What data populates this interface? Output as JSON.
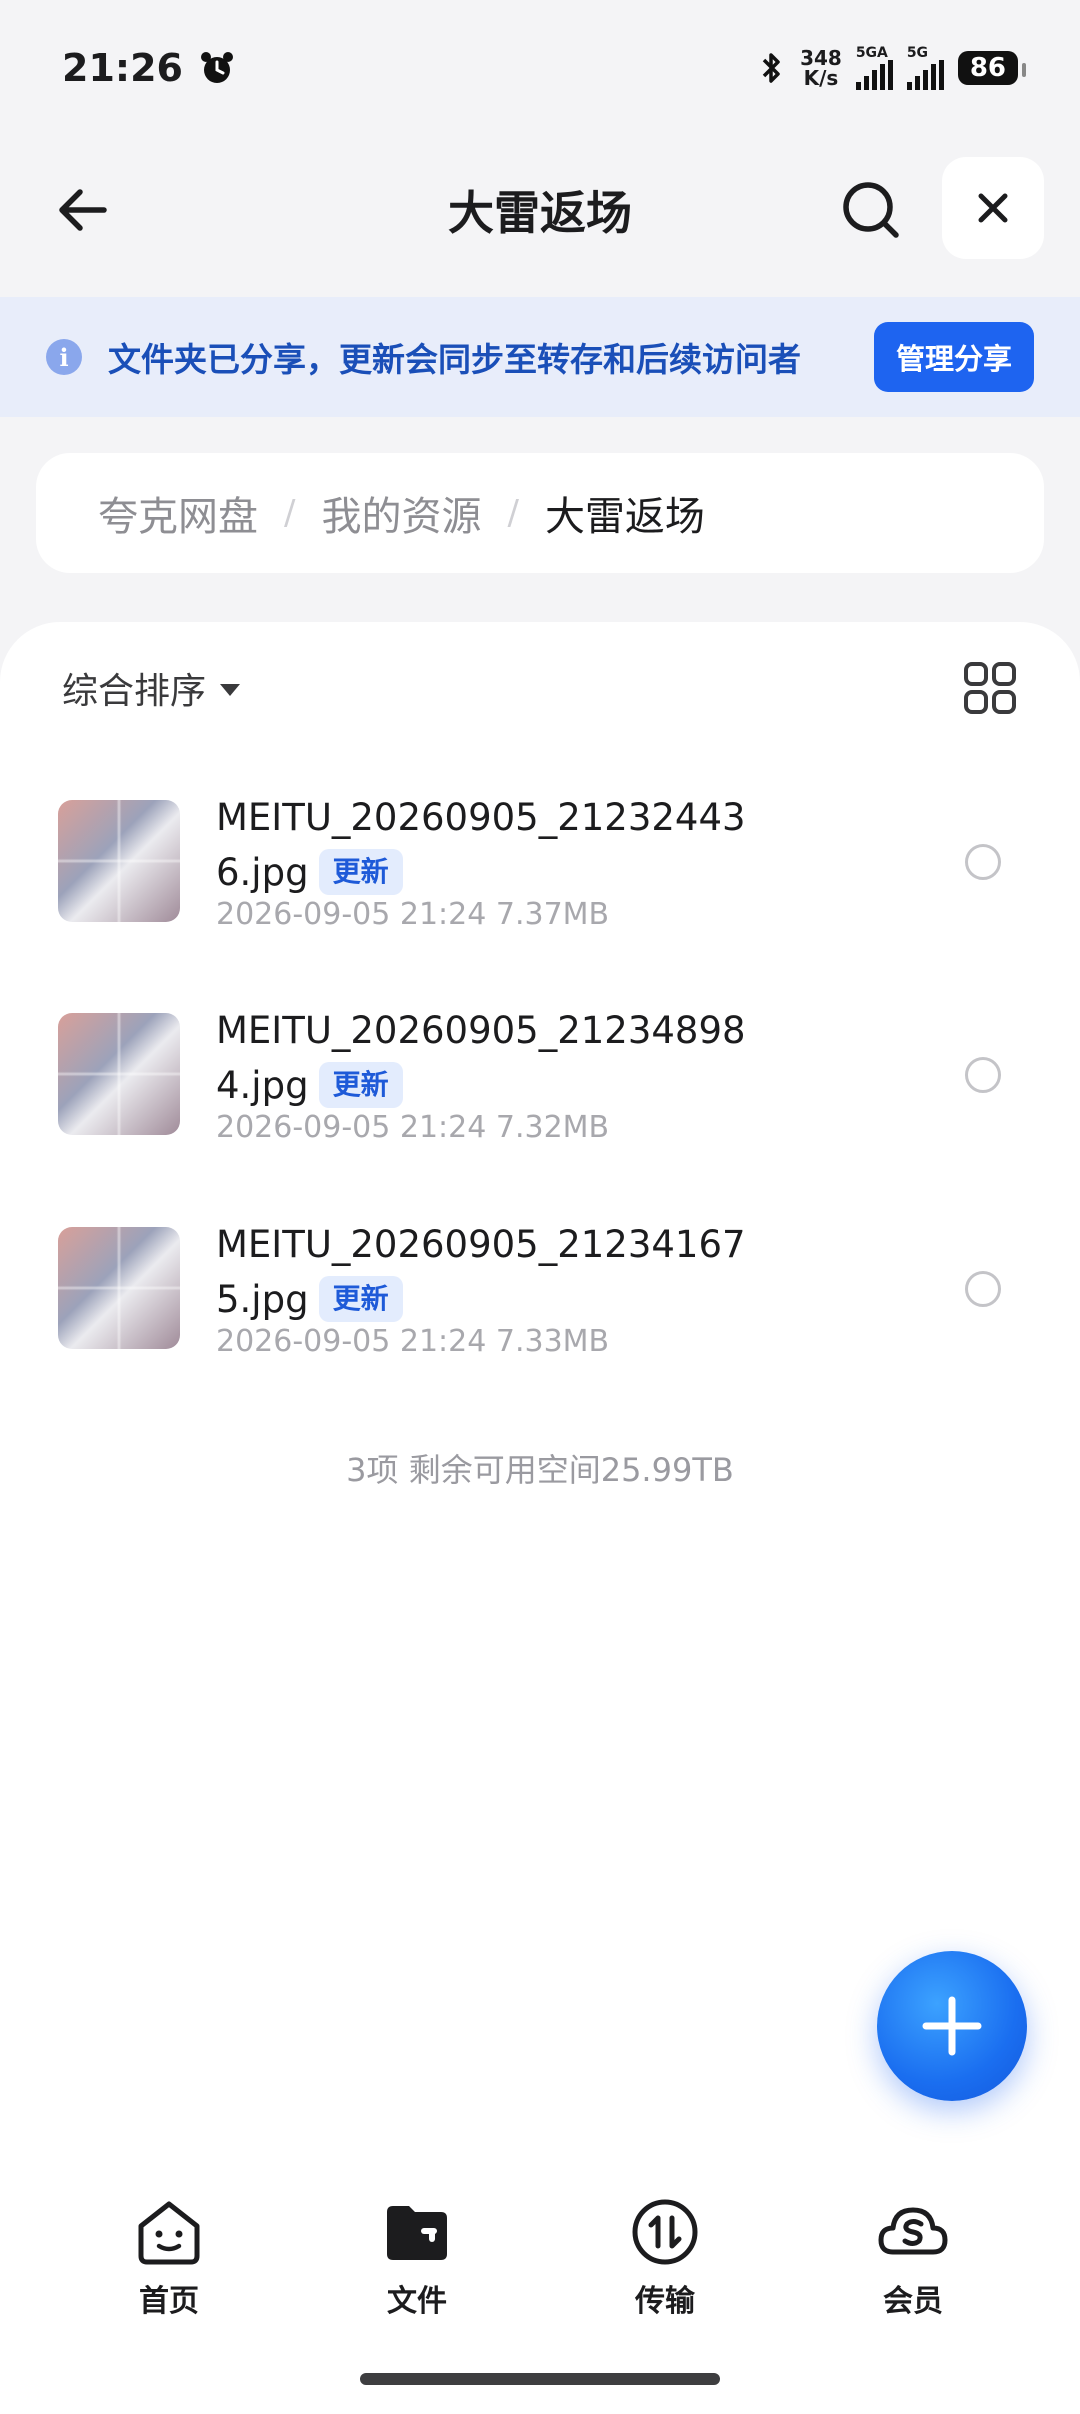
{
  "status_bar": {
    "time": "21:26",
    "speed_value": "348",
    "speed_unit": "K/s",
    "net1": "5GA",
    "net2": "5G",
    "battery": "86"
  },
  "nav": {
    "title": "大雷返场"
  },
  "share_banner": {
    "text": "文件夹已分享，更新会同步至转存和后续访问者",
    "button_label": "管理分享"
  },
  "breadcrumb": {
    "items": [
      "夸克网盘",
      "我的资源"
    ],
    "current": "大雷返场",
    "separator": "/"
  },
  "toolbar": {
    "sort_label": "综合排序"
  },
  "files": [
    {
      "name": "MEITU_20260905_212324436.jpg",
      "badge": "更新",
      "meta": "2026-09-05 21:24  7.37MB"
    },
    {
      "name": "MEITU_20260905_212348984.jpg",
      "badge": "更新",
      "meta": "2026-09-05 21:24  7.32MB"
    },
    {
      "name": "MEITU_20260905_212341675.jpg",
      "badge": "更新",
      "meta": "2026-09-05 21:24  7.33MB"
    }
  ],
  "footer": {
    "summary": "3项 剩余可用空间25.99TB"
  },
  "tab_bar": {
    "tabs": [
      {
        "label": "首页",
        "icon": "home-face-icon"
      },
      {
        "label": "文件",
        "icon": "folder-icon"
      },
      {
        "label": "传输",
        "icon": "transfer-icon"
      },
      {
        "label": "会员",
        "icon": "cloud-s-icon"
      }
    ],
    "active": "文件"
  },
  "colors": {
    "accent": "#1e64f0",
    "banner_bg": "#e8edfa",
    "badge_bg": "#e3ecfd"
  }
}
